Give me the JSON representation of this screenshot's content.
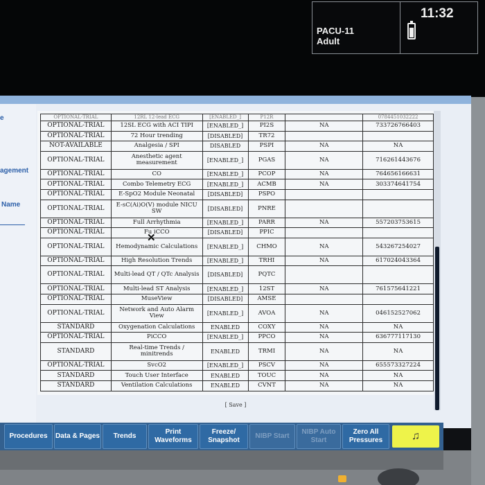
{
  "header": {
    "bed_line1": "PACU-11",
    "bed_line2": "Adult",
    "clock": "11:32",
    "battery_icon": "battery-icon"
  },
  "side_labels": {
    "l1": "e",
    "l2": "agement",
    "l3": "Name"
  },
  "table": {
    "cut_row": [
      "OPTIONAL-TRIAL",
      "12RL 12-lead ECG",
      "[ENABLED_]",
      "P12R",
      "",
      "0784451032222"
    ],
    "rows": [
      [
        "OPTIONAL-TRIAL",
        "12SL ECG with ACI TIPI",
        "[ENABLED_]",
        "PI2S",
        "NA",
        "733726766403"
      ],
      [
        "OPTIONAL-TRIAL",
        "72 Hour trending",
        "[DISABLED]",
        "TR72",
        "",
        ""
      ],
      [
        "NOT-AVAILABLE",
        "Analgesia / SPI",
        "DISABLED",
        "PSPI",
        "NA",
        "NA"
      ],
      [
        "OPTIONAL-TRIAL",
        "Anesthetic agent measurement",
        "[ENABLED_]",
        "PGAS",
        "NA",
        "716261443676"
      ],
      [
        "OPTIONAL-TRIAL",
        "CO",
        "[ENABLED_]",
        "PCOP",
        "NA",
        "764656166631"
      ],
      [
        "OPTIONAL-TRIAL",
        "Combo Telemetry ECG",
        "[ENABLED_]",
        "ACMB",
        "NA",
        "303374641754"
      ],
      [
        "OPTIONAL-TRIAL",
        "E-SpO2 Module Neonatal",
        "[DISABLED]",
        "PSPO",
        "",
        ""
      ],
      [
        "OPTIONAL-TRIAL",
        "E-sC(Ai)O(V) module NICU SW",
        "[DISABLED]",
        "PNRE",
        "",
        ""
      ],
      [
        "OPTIONAL-TRIAL",
        "Full Arrhythmia",
        "[ENABLED_]",
        "PARR",
        "NA",
        "557203753615"
      ],
      [
        "OPTIONAL-TRIAL",
        "Fu  iCCO",
        "[DISABLED]",
        "PPIC",
        "",
        ""
      ],
      [
        "OPTIONAL-TRIAL",
        "Hemodynamic Calculations",
        "[ENABLED_]",
        "CHMO",
        "NA",
        "543267254027"
      ],
      [
        "OPTIONAL-TRIAL",
        "High Resolution Trends",
        "[ENABLED_]",
        "TRHI",
        "NA",
        "617024043364"
      ],
      [
        "OPTIONAL-TRIAL",
        "Multi-lead QT / QTc Analysis",
        "[DISABLED]",
        "PQTC",
        "",
        ""
      ],
      [
        "OPTIONAL-TRIAL",
        "Multi-lead ST Analysis",
        "[ENABLED_]",
        "12ST",
        "NA",
        "761575641221"
      ],
      [
        "OPTIONAL-TRIAL",
        "MuseView",
        "[DISABLED]",
        "AMSE",
        "",
        ""
      ],
      [
        "OPTIONAL-TRIAL",
        "Network and Auto Alarm View",
        "[ENABLED_]",
        "AVOA",
        "NA",
        "046152527062"
      ],
      [
        "STANDARD",
        "Oxygenation Calculations",
        "ENABLED",
        "COXY",
        "NA",
        "NA"
      ],
      [
        "OPTIONAL-TRIAL",
        "PiCCO",
        "[ENABLED_]",
        "PPCO",
        "NA",
        "636777117130"
      ],
      [
        "STANDARD",
        "Real-time Trends / minitrends",
        "ENABLED",
        "TRMI",
        "NA",
        "NA"
      ],
      [
        "OPTIONAL-TRIAL",
        "SvcO2",
        "[ENABLED_]",
        "PSCV",
        "NA",
        "655573327224"
      ],
      [
        "STANDARD",
        "Touch User Interface",
        "ENABLED",
        "TOUC",
        "NA",
        "NA"
      ],
      [
        "STANDARD",
        "Ventilation Calculations",
        "ENABLED",
        "CVNT",
        "NA",
        "NA"
      ]
    ],
    "save_label": "[ Save ]"
  },
  "softkeys": [
    {
      "label": "Procedures",
      "enabled": true
    },
    {
      "label": "Data & Pages",
      "enabled": true
    },
    {
      "label": "Trends",
      "enabled": true
    },
    {
      "label": "Print Waveforms",
      "enabled": true
    },
    {
      "label": "Freeze/ Snapshot",
      "enabled": true
    },
    {
      "label": "NIBP Start",
      "enabled": false
    },
    {
      "label": "NIBP Auto Start",
      "enabled": false
    },
    {
      "label": "Zero All Pressures",
      "enabled": true
    }
  ],
  "alarm_key_icon": "bell-icon",
  "colors": {
    "accent_blue": "#2a5ea8",
    "softkey_bar": "#33608f",
    "alarm_key": "#eef34a"
  }
}
